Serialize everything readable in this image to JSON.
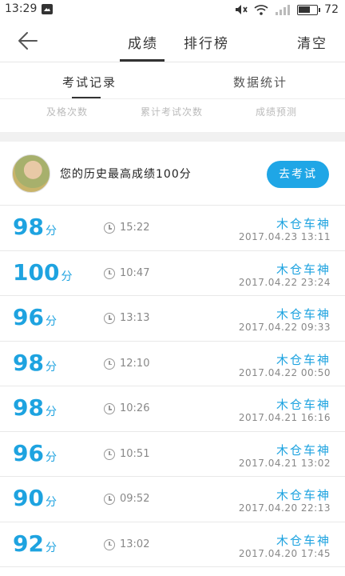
{
  "status_bar": {
    "time": "13:29",
    "battery": "72"
  },
  "header": {
    "tabs": [
      "成绩",
      "排行榜"
    ],
    "clear_label": "清空"
  },
  "subtabs": {
    "items": [
      "考试记录",
      "数据统计"
    ]
  },
  "stats_labels": [
    "及格次数",
    "累计考试次数",
    "成绩预测"
  ],
  "best": {
    "text": "您的历史最高成绩100分",
    "button_label": "去考试"
  },
  "records": [
    {
      "score": "98",
      "unit": "分",
      "duration": "15:22",
      "title": "木仓车神",
      "datetime": "2017.04.23   13:11"
    },
    {
      "score": "100",
      "unit": "分",
      "duration": "10:47",
      "title": "木仓车神",
      "datetime": "2017.04.22   23:24"
    },
    {
      "score": "96",
      "unit": "分",
      "duration": "13:13",
      "title": "木仓车神",
      "datetime": "2017.04.22   09:33"
    },
    {
      "score": "98",
      "unit": "分",
      "duration": "12:10",
      "title": "木仓车神",
      "datetime": "2017.04.22   00:50"
    },
    {
      "score": "98",
      "unit": "分",
      "duration": "10:26",
      "title": "木仓车神",
      "datetime": "2017.04.21   16:16"
    },
    {
      "score": "96",
      "unit": "分",
      "duration": "10:51",
      "title": "木仓车神",
      "datetime": "2017.04.21   13:02"
    },
    {
      "score": "90",
      "unit": "分",
      "duration": "09:52",
      "title": "木仓车神",
      "datetime": "2017.04.20   22:13"
    },
    {
      "score": "92",
      "unit": "分",
      "duration": "13:02",
      "title": "木仓车神",
      "datetime": "2017.04.20   17:45"
    }
  ],
  "colors": {
    "accent": "#1ea3e0",
    "button": "#1fa6e6"
  },
  "icons": {
    "back": "arrow-left-icon",
    "clock": "clock-icon"
  }
}
